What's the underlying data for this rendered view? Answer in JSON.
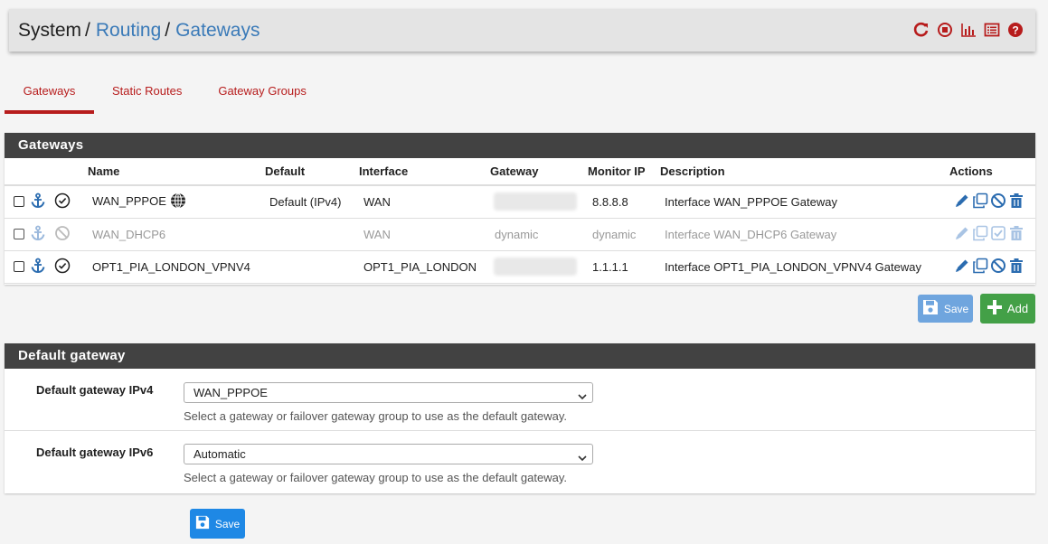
{
  "breadcrumb": {
    "system": "System",
    "routing": "Routing",
    "gateways": "Gateways",
    "sep": "/"
  },
  "tabs": [
    {
      "label": "Gateways",
      "active": true
    },
    {
      "label": "Static Routes",
      "active": false
    },
    {
      "label": "Gateway Groups",
      "active": false
    }
  ],
  "gateways_panel": {
    "title": "Gateways",
    "columns": {
      "name": "Name",
      "default": "Default",
      "interface": "Interface",
      "gateway": "Gateway",
      "monitor_ip": "Monitor IP",
      "description": "Description",
      "actions": "Actions"
    },
    "rows": [
      {
        "name": "WAN_PPPOE",
        "default": "Default (IPv4)",
        "interface": "WAN",
        "gateway": "",
        "monitor_ip": "8.8.8.8",
        "description": "Interface WAN_PPPOE Gateway",
        "disabled": false
      },
      {
        "name": "WAN_DHCP6",
        "default": "",
        "interface": "WAN",
        "gateway": "dynamic",
        "monitor_ip": "dynamic",
        "description": "Interface WAN_DHCP6 Gateway",
        "disabled": true
      },
      {
        "name": "OPT1_PIA_LONDON_VPNV4",
        "default": "",
        "interface": "OPT1_PIA_LONDON",
        "gateway": "",
        "monitor_ip": "1.1.1.1",
        "description": "Interface OPT1_PIA_LONDON_VPNV4 Gateway",
        "disabled": false
      }
    ],
    "save_label": "Save",
    "add_label": "Add"
  },
  "default_gateway_panel": {
    "title": "Default gateway",
    "ipv4": {
      "label": "Default gateway IPv4",
      "value": "WAN_PPPOE",
      "help": "Select a gateway or failover gateway group to use as the default gateway."
    },
    "ipv6": {
      "label": "Default gateway IPv6",
      "value": "Automatic",
      "help": "Select a gateway or failover gateway group to use as the default gateway."
    },
    "save_label": "Save"
  },
  "colors": {
    "accent_red": "#b71c1c",
    "link_blue": "#3a7ab8",
    "panel_head": "#424242",
    "add_green": "#43a047",
    "save_blue": "#1e88e5",
    "icon_blue": "#2b6cb0"
  },
  "icons": [
    "reload-icon",
    "stop-icon",
    "chart-icon",
    "log-icon",
    "help-icon",
    "anchor-icon",
    "check-circle-icon",
    "ban-icon",
    "globe-icon",
    "pencil-icon",
    "copy-icon",
    "disable-icon",
    "trash-icon",
    "floppy-icon",
    "plus-icon"
  ]
}
